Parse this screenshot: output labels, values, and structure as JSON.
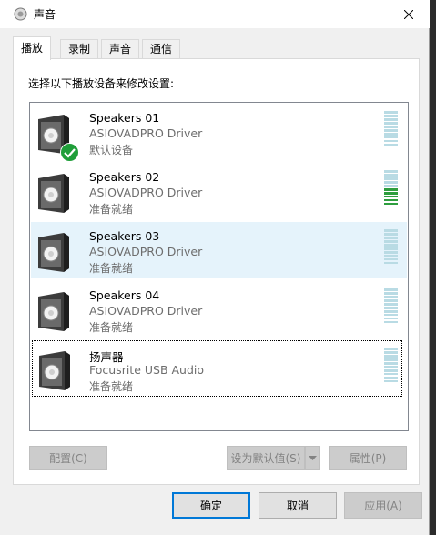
{
  "window": {
    "title": "声音",
    "icon": "speaker-icon",
    "close_icon": "close-icon"
  },
  "tabs": [
    {
      "label": "播放",
      "active": true
    },
    {
      "label": "录制",
      "active": false
    },
    {
      "label": "声音",
      "active": false
    },
    {
      "label": "通信",
      "active": false
    }
  ],
  "instruction": "选择以下播放设备来修改设置:",
  "devices": [
    {
      "name": "Speakers 01",
      "driver": "ASIOVADPRO Driver",
      "status": "默认设备",
      "default": true,
      "selected": false,
      "level": 0
    },
    {
      "name": "Speakers 02",
      "driver": "ASIOVADPRO Driver",
      "status": "准备就绪",
      "default": false,
      "selected": false,
      "level": 0.5
    },
    {
      "name": "Speakers 03",
      "driver": "ASIOVADPRO Driver",
      "status": "准备就绪",
      "default": false,
      "selected": true,
      "level": 0
    },
    {
      "name": "Speakers 04",
      "driver": "ASIOVADPRO Driver",
      "status": "准备就绪",
      "default": false,
      "selected": false,
      "level": 0
    },
    {
      "name": "扬声器",
      "driver": "Focusrite USB Audio",
      "status": "准备就绪",
      "default": false,
      "selected": false,
      "focused": true,
      "level": 0
    }
  ],
  "panel_buttons": {
    "configure": "配置(C)",
    "set_default": "设为默认值(S)",
    "properties": "属性(P)"
  },
  "dialog_buttons": {
    "ok": "确定",
    "cancel": "取消",
    "apply": "应用(A)"
  },
  "colors": {
    "selection": "#e5f3fb",
    "meter_idle": "#b9dbe4",
    "meter_active": "#2e9e3e",
    "default_check": "#1f9e39",
    "focus_border": "#0078d7"
  }
}
